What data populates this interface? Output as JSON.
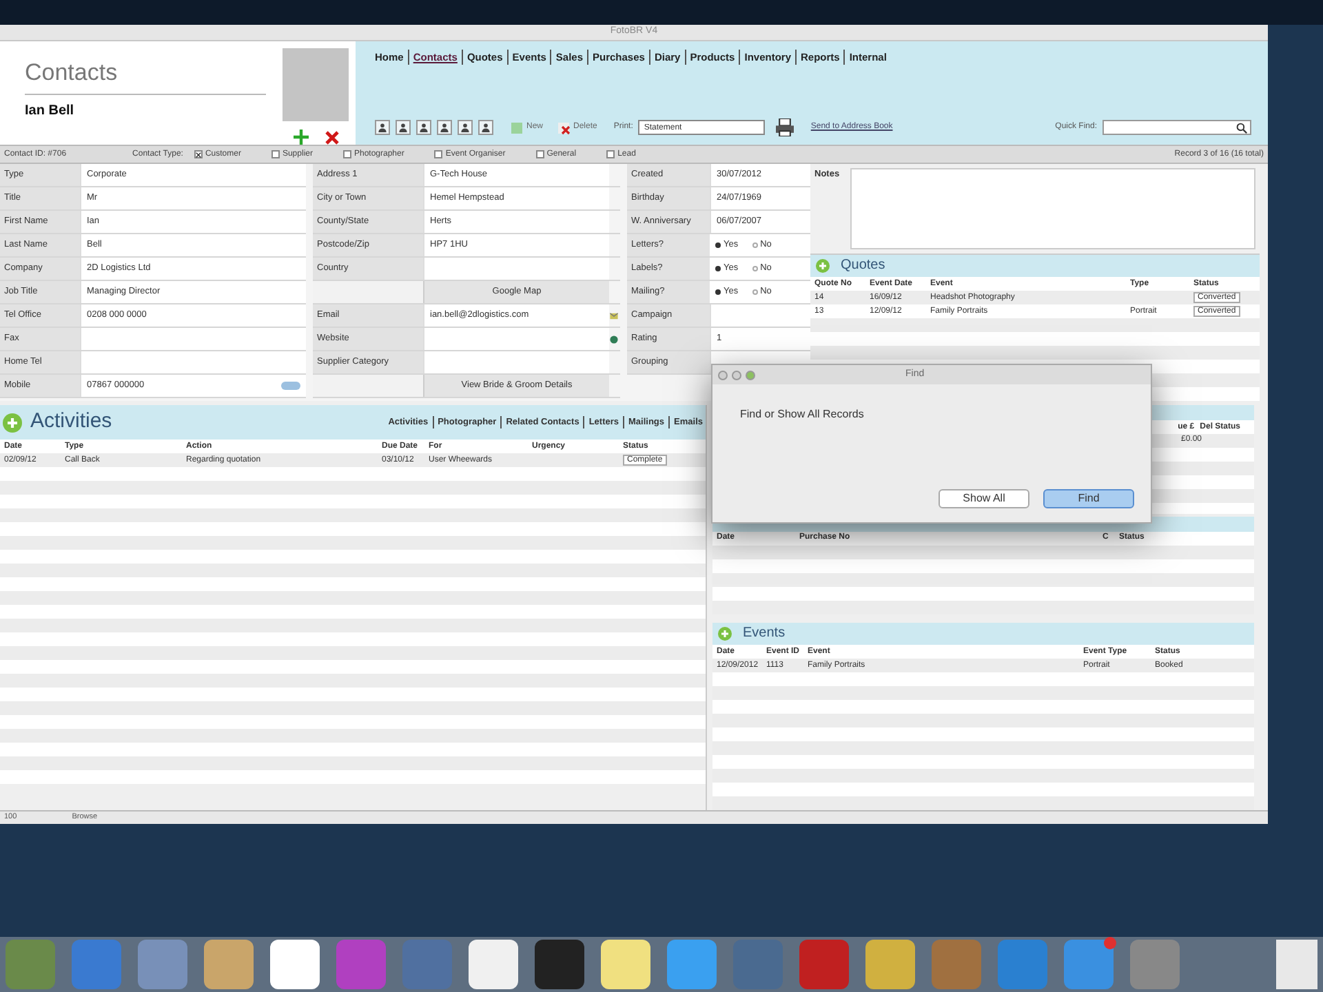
{
  "window": {
    "title": "FotoBR V4"
  },
  "header": {
    "module": "Contacts",
    "contact_name": "Ian Bell"
  },
  "nav": [
    {
      "label": "Home",
      "selected": false
    },
    {
      "label": "Contacts",
      "selected": true
    },
    {
      "label": "Quotes",
      "selected": false
    },
    {
      "label": "Events",
      "selected": false
    },
    {
      "label": "Sales",
      "selected": false
    },
    {
      "label": "Purchases",
      "selected": false
    },
    {
      "label": "Diary",
      "selected": false
    },
    {
      "label": "Products",
      "selected": false
    },
    {
      "label": "Inventory",
      "selected": false
    },
    {
      "label": "Reports",
      "selected": false
    },
    {
      "label": "Internal",
      "selected": false
    }
  ],
  "toolbar": {
    "new_label": "New",
    "delete_label": "Delete",
    "print_label": "Print:",
    "print_value": "Statement",
    "address_book_link": "Send to Address Book",
    "quick_find_label": "Quick Find:"
  },
  "contact_bar": {
    "contact_id": "Contact ID: #706",
    "type_label": "Contact Type:",
    "record": "Record 3 of 16 (16 total)",
    "types": [
      {
        "label": "Customer",
        "checked": true
      },
      {
        "label": "Supplier",
        "checked": false
      },
      {
        "label": "Photographer",
        "checked": false
      },
      {
        "label": "Event Organiser",
        "checked": false
      },
      {
        "label": "General",
        "checked": false
      },
      {
        "label": "Lead",
        "checked": false
      }
    ]
  },
  "form": {
    "column_1": [
      {
        "kind": "field",
        "label": "Type",
        "value": "Corporate"
      },
      {
        "kind": "field",
        "label": "Title",
        "value": "Mr"
      },
      {
        "kind": "field",
        "label": "First Name",
        "value": "Ian"
      },
      {
        "kind": "field",
        "label": "Last Name",
        "value": "Bell"
      },
      {
        "kind": "field",
        "label": "Company",
        "value": "2D Logistics Ltd"
      },
      {
        "kind": "field",
        "label": "Job Title",
        "value": "Managing Director"
      },
      {
        "kind": "field",
        "label": "Tel Office",
        "value": "0208 000 0000"
      },
      {
        "kind": "field",
        "label": "Fax"
      },
      {
        "kind": "field",
        "label": "Home Tel"
      },
      {
        "kind": "field",
        "label": "Mobile",
        "value": "07867 000000",
        "sms_button": true
      }
    ],
    "column_2": [
      {
        "kind": "field",
        "label": "Address 1",
        "value": "G-Tech House"
      },
      {
        "kind": "field",
        "label": "City or Town",
        "value": "Hemel Hempstead"
      },
      {
        "kind": "field",
        "label": "County/State",
        "value": "Herts"
      },
      {
        "kind": "field",
        "label": "Postcode/Zip",
        "value": "HP7 1HU"
      },
      {
        "kind": "field",
        "label": "Country"
      },
      {
        "kind": "button",
        "label": "Google Map"
      },
      {
        "kind": "field",
        "label": "Email",
        "value": "ian.bell@2dlogistics.com",
        "mail_button": true
      },
      {
        "kind": "field",
        "label": "Website",
        "web_button": true
      },
      {
        "kind": "field",
        "label": "Supplier Category"
      },
      {
        "kind": "button",
        "label": "View Bride & Groom Details"
      }
    ],
    "column_3": [
      {
        "kind": "field",
        "label": "Created",
        "value": "30/07/2012"
      },
      {
        "kind": "field",
        "label": "Birthday",
        "value": "24/07/1969"
      },
      {
        "kind": "field",
        "label": "W. Anniversary",
        "value": "06/07/2007"
      },
      {
        "kind": "radio",
        "label": "Letters?",
        "options": [
          {
            "label": "Yes",
            "selected": true
          },
          {
            "label": "No",
            "selected": false
          }
        ]
      },
      {
        "kind": "radio",
        "label": "Labels?",
        "options": [
          {
            "label": "Yes",
            "selected": true
          },
          {
            "label": "No",
            "selected": false
          }
        ]
      },
      {
        "kind": "radio",
        "label": "Mailing?",
        "options": [
          {
            "label": "Yes",
            "selected": true
          },
          {
            "label": "No",
            "selected": false
          }
        ]
      },
      {
        "kind": "field",
        "label": "Campaign"
      },
      {
        "kind": "field",
        "label": "Rating",
        "value": "1"
      },
      {
        "kind": "field",
        "label": "Grouping"
      }
    ]
  },
  "notes": {
    "label": "Notes"
  },
  "quotes": {
    "title": "Quotes",
    "columns": [
      "Quote No",
      "Event Date",
      "Event",
      "Type",
      "Status"
    ],
    "rows": [
      [
        "14",
        "16/09/12",
        "Headshot Photography",
        "",
        "Converted"
      ],
      [
        "13",
        "12/09/12",
        "Family Portraits",
        "Portrait",
        "Converted"
      ]
    ]
  },
  "activities": {
    "title": "Activities",
    "tabs": [
      "Activities",
      "Photographer",
      "Related Contacts",
      "Letters",
      "Mailings",
      "Emails"
    ],
    "columns": [
      "Date",
      "Type",
      "Action",
      "Due Date",
      "For",
      "Urgency",
      "Status"
    ],
    "rows": [
      [
        "02/09/12",
        "Call Back",
        "Regarding quotation",
        "03/10/12",
        "User Wheewards",
        "",
        "Complete"
      ]
    ]
  },
  "sales_partial": {
    "columns": [
      "ue £",
      "Del Status"
    ],
    "rows": [
      [
        "£0.00",
        ""
      ]
    ]
  },
  "purchases": {
    "columns": [
      "Date",
      "Purchase No",
      "C",
      "Status"
    ]
  },
  "events": {
    "title": "Events",
    "columns": [
      "Date",
      "Event ID",
      "Event",
      "Event Type",
      "Status"
    ],
    "rows": [
      [
        "12/09/2012",
        "1113",
        "Family Portraits",
        "Portrait",
        "Booked"
      ]
    ]
  },
  "find_dialog": {
    "title": "Find",
    "message": "Find or Show All Records",
    "buttons": [
      {
        "label": "Show All",
        "default": false
      },
      {
        "label": "Find",
        "default": true
      }
    ]
  },
  "status_bar": {
    "zoom": "100",
    "mode": "Browse"
  }
}
